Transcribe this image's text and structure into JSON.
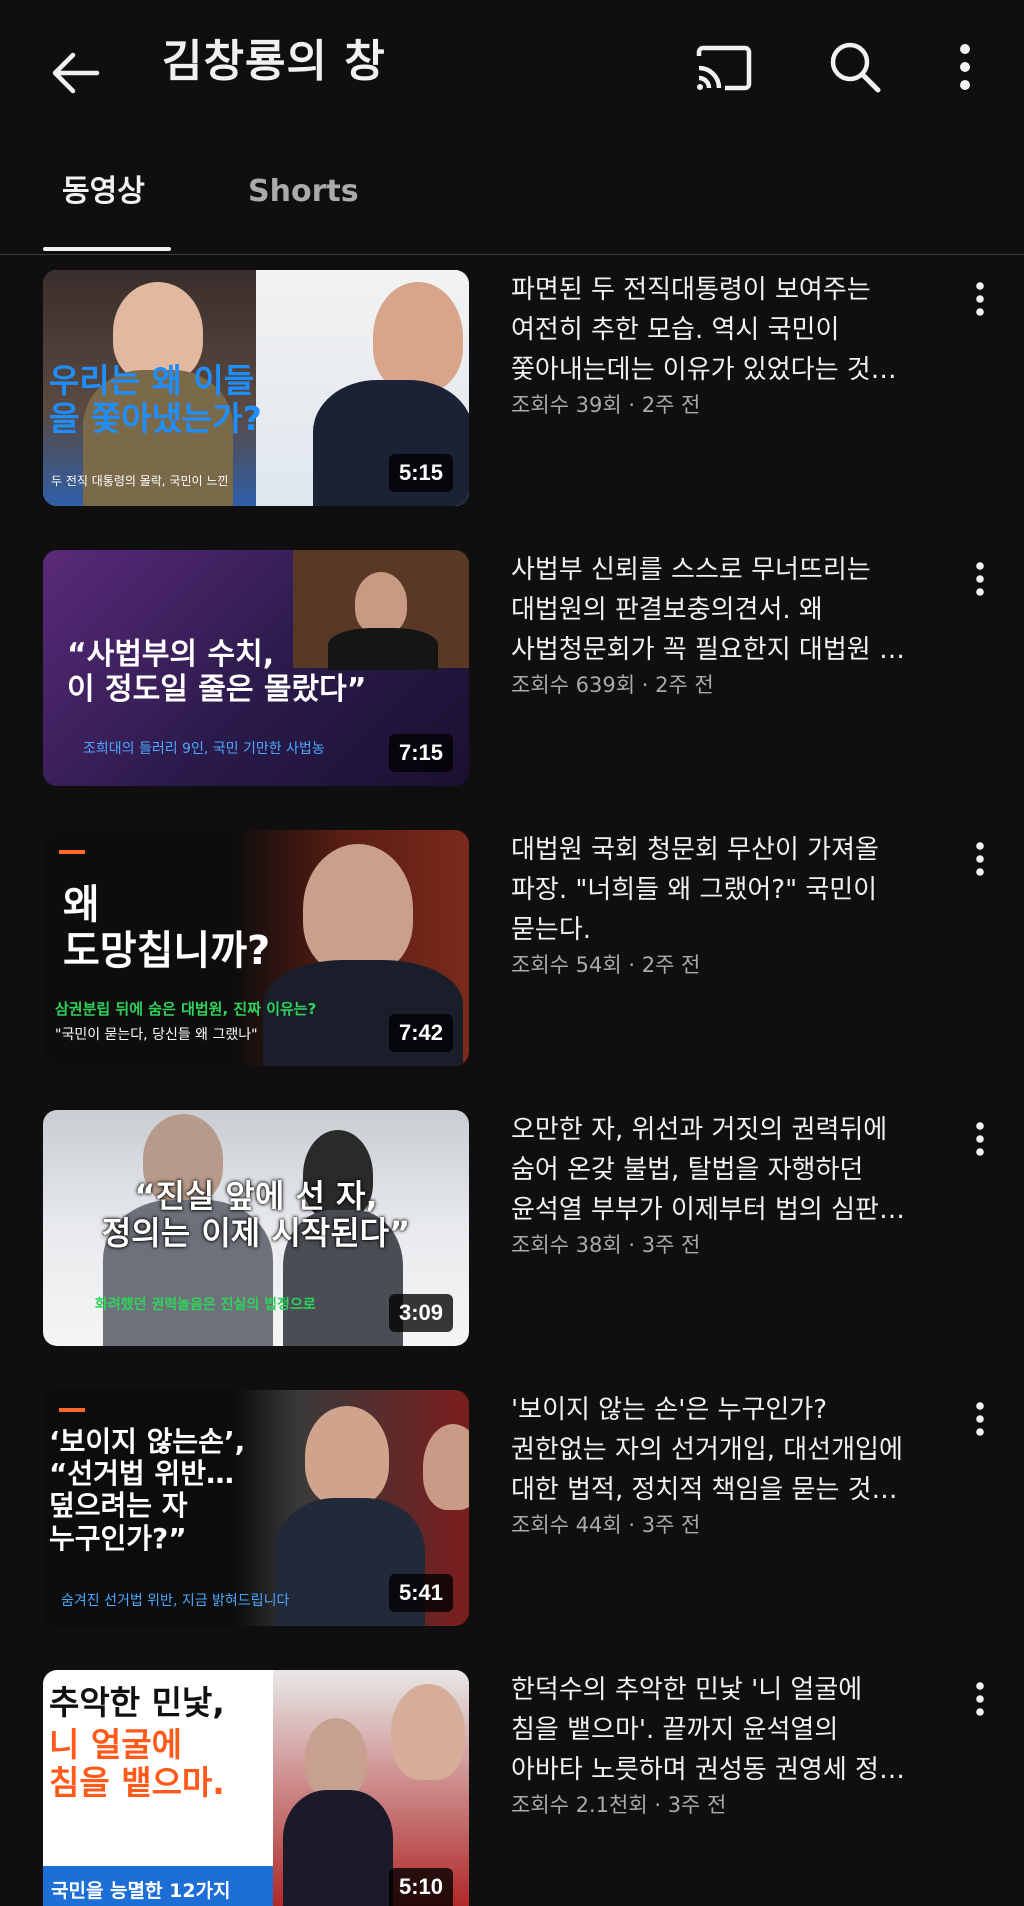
{
  "header": {
    "title": "김창룡의 창",
    "icons": [
      "back-arrow-icon",
      "cast-icon",
      "search-icon",
      "more-vert-icon"
    ]
  },
  "tabs": [
    {
      "label": "동영상",
      "active": true
    },
    {
      "label": "Shorts",
      "active": false
    }
  ],
  "videos": [
    {
      "title": "파면된 두 전직대통령이 보여주는\n여전히 추한 모습. 역시 국민이\n쫓아내는데는 이유가 있었다는 것…",
      "meta": "조회수 39회 · 2주 전",
      "duration": "5:15",
      "thumb_text": "우리는 왜 이들\n을 쫓아냈는가?",
      "thumb_sub": "두 전직 대통령의 몰락, 국민이 느낀"
    },
    {
      "title": "사법부 신뢰를 스스로 무너뜨리는\n대법원의 판결보충의견서. 왜\n사법청문회가 꼭 필요한지 대법원 …",
      "meta": "조회수 639회 · 2주 전",
      "duration": "7:15",
      "thumb_text": "“사법부의 수치,\n이 정도일 줄은 몰랐다”",
      "thumb_sub": "조희대의 들러리 9인, 국민 기만한 사법농"
    },
    {
      "title": "대법원 국회 청문회 무산이 가져올\n파장. \"너희들 왜 그랬어?\" 국민이\n묻는다.",
      "meta": "조회수 54회 · 2주 전",
      "duration": "7:42",
      "thumb_text": "왜\n도망칩니까?",
      "thumb_sub": "삼권분립 뒤에 숨은 대법원, 진짜 이유는?",
      "thumb_sub2": "\"국민이 묻는다, 당신들 왜 그랬나\""
    },
    {
      "title": "오만한 자, 위선과 거짓의 권력뒤에\n숨어 온갖 불법, 탈법을 자행하던\n윤석열 부부가 이제부터 법의 심판…",
      "meta": "조회수 38회 · 3주 전",
      "duration": "3:09",
      "thumb_text": "“진실 앞에 선 자,\n정의는 이제 시작된다”",
      "thumb_sub": "화려했던 권력놀음은 진실의 법정으로"
    },
    {
      "title": "'보이지 않는 손'은 누구인가?\n권한없는 자의 선거개입, 대선개입에\n대한 법적, 정치적 책임을 묻는 것…",
      "meta": "조회수 44회 · 3주 전",
      "duration": "5:41",
      "thumb_text": "‘보이지 않는손’,\n“선거법 위반…\n덮으려는 자\n누구인가?”",
      "thumb_sub": "숨겨진 선거법 위반, 지금 밝혀드립니다"
    },
    {
      "title": "한덕수의 추악한 민낯 '니 얼굴에\n침을 뱉으마'. 끝까지 윤석열의\n아바타 노릇하며 권성동 권영세 정…",
      "meta": "조회수 2.1천회 · 3주 전",
      "duration": "5:10",
      "thumb_text_a": "추악한 민낯,",
      "thumb_text_b": "니 얼굴에\n침을 뱉으마.",
      "thumb_sub": "국민을 능멸한 12가지"
    }
  ]
}
